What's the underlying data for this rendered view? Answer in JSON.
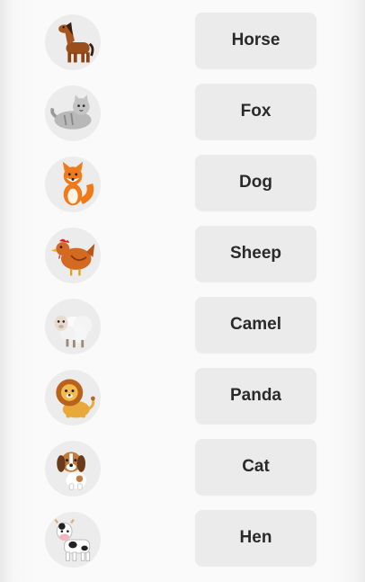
{
  "items": [
    {
      "animal_icon": "horse-icon",
      "label": "Horse"
    },
    {
      "animal_icon": "cat-icon",
      "label": "Fox"
    },
    {
      "animal_icon": "fox-icon",
      "label": "Dog"
    },
    {
      "animal_icon": "hen-icon",
      "label": "Sheep"
    },
    {
      "animal_icon": "sheep-icon",
      "label": "Camel"
    },
    {
      "animal_icon": "lion-icon",
      "label": "Panda"
    },
    {
      "animal_icon": "dog-icon",
      "label": "Cat"
    },
    {
      "animal_icon": "cow-icon",
      "label": "Hen"
    }
  ],
  "colors": {
    "button_bg": "#ebebeb",
    "text": "#2a2a2a",
    "thumb_bg": "#ececec"
  }
}
